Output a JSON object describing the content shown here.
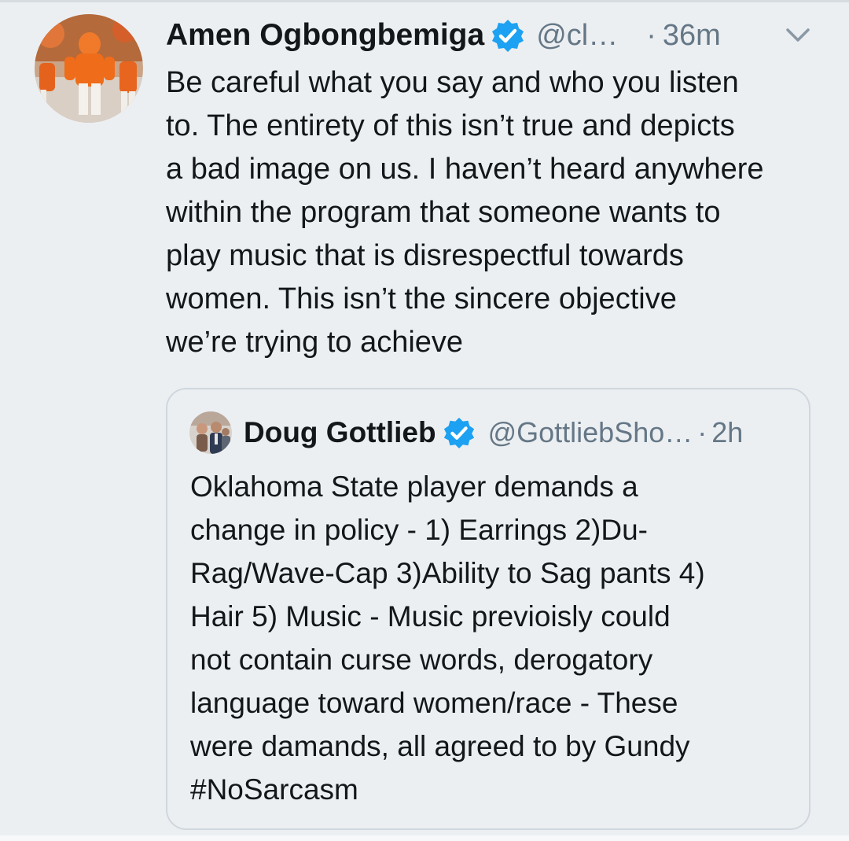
{
  "tweet": {
    "author": {
      "display_name": "Amen Ogbongbemiga",
      "handle": "@cl…",
      "verified": true,
      "avatar_icon": "football-player-avatar"
    },
    "separator": "·",
    "time": "36m",
    "menu_icon": "chevron-down-icon",
    "text_lines": [
      "Be careful what you say and who you listen",
      "to. The entirety of this isn’t true and depicts",
      "a bad image on us. I haven’t heard anywhere",
      "within the program that someone wants to",
      "play music that is disrespectful towards",
      "women. This isn’t the sincere objective",
      "we’re trying to achieve"
    ]
  },
  "quoted_tweet": {
    "author": {
      "display_name": "Doug Gottlieb",
      "handle": "@GottliebSho…",
      "verified": true,
      "avatar_icon": "person-avatar"
    },
    "separator": "·",
    "time": "2h",
    "text_lines": [
      "Oklahoma State player demands a",
      "change in policy - 1) Earrings 2)Du-",
      "Rag/Wave-Cap 3)Ability to Sag pants 4)",
      "Hair 5) Music - Music previoisly could",
      "not contain curse words, derogatory",
      "language toward women/race - These",
      "were damands, all agreed to by Gundy",
      "#NoSarcasm"
    ]
  },
  "colors": {
    "background": "#eceff2",
    "text_primary": "#14171a",
    "text_secondary": "#657786",
    "verified_blue": "#1da1f2",
    "card_border": "#cfd7de"
  }
}
